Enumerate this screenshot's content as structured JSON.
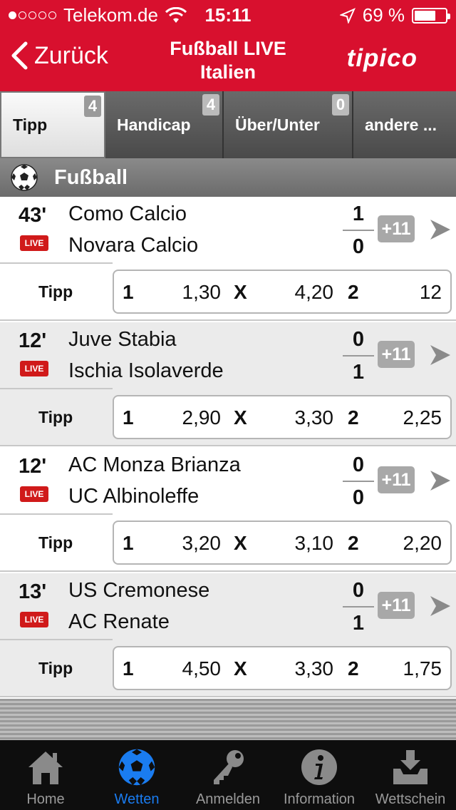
{
  "status_bar": {
    "carrier": "Telekom.de",
    "time": "15:11",
    "battery": "69 %",
    "battery_level": 0.69
  },
  "header": {
    "back_label": "Zurück",
    "title_line1": "Fußball LIVE",
    "title_line2": "Italien",
    "logo": "tipico",
    "color": "#d8102e"
  },
  "tabs": [
    {
      "label": "Tipp",
      "count": "4",
      "active": true
    },
    {
      "label": "Handicap",
      "count": "4",
      "active": false
    },
    {
      "label": "Über/Unter",
      "count": "0",
      "active": false
    },
    {
      "label": "andere ...",
      "count": "",
      "active": false
    }
  ],
  "section": {
    "title": "Fußball",
    "icon": "soccer-ball-icon"
  },
  "matches": [
    {
      "minute": "43'",
      "live": "LIVE",
      "team1": "Como Calcio",
      "team2": "Novara Calcio",
      "score1": "1",
      "score2": "0",
      "more": "+11",
      "bet_label": "Tipp",
      "o1_label": "1",
      "o1": "1,30",
      "ox_label": "X",
      "ox": "4,20",
      "o2_label": "2",
      "o2": "12"
    },
    {
      "minute": "12'",
      "live": "LIVE",
      "team1": "Juve Stabia",
      "team2": "Ischia Isolaverde",
      "score1": "0",
      "score2": "1",
      "more": "+11",
      "bet_label": "Tipp",
      "o1_label": "1",
      "o1": "2,90",
      "ox_label": "X",
      "ox": "3,30",
      "o2_label": "2",
      "o2": "2,25"
    },
    {
      "minute": "12'",
      "live": "LIVE",
      "team1": "AC Monza Brianza",
      "team2": "UC Albinoleffe",
      "score1": "0",
      "score2": "0",
      "more": "+11",
      "bet_label": "Tipp",
      "o1_label": "1",
      "o1": "3,20",
      "ox_label": "X",
      "ox": "3,10",
      "o2_label": "2",
      "o2": "2,20"
    },
    {
      "minute": "13'",
      "live": "LIVE",
      "team1": "US Cremonese",
      "team2": "AC Renate",
      "score1": "0",
      "score2": "1",
      "more": "+11",
      "bet_label": "Tipp",
      "o1_label": "1",
      "o1": "4,50",
      "ox_label": "X",
      "ox": "3,30",
      "o2_label": "2",
      "o2": "1,75"
    }
  ],
  "tabbar": [
    {
      "label": "Home",
      "icon": "home-icon",
      "active": false
    },
    {
      "label": "Wetten",
      "icon": "soccer-ball-icon",
      "active": true
    },
    {
      "label": "Anmelden",
      "icon": "key-icon",
      "active": false
    },
    {
      "label": "Information",
      "icon": "info-icon",
      "active": false
    },
    {
      "label": "Wettschein",
      "icon": "download-tray-icon",
      "active": false
    }
  ],
  "colors": {
    "accent": "#d8102e",
    "active_tab": "#1a7cf0",
    "live_badge": "#d01a1a"
  }
}
